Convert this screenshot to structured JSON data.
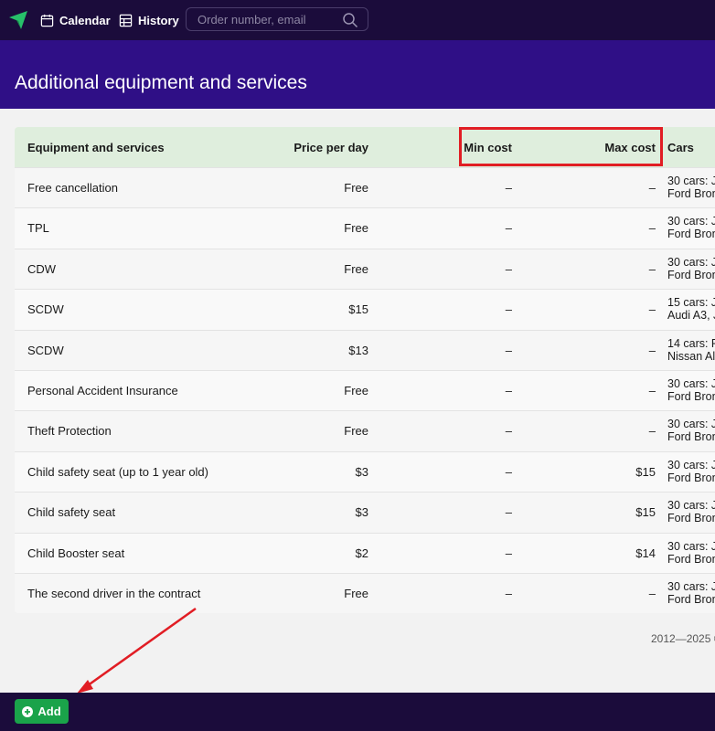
{
  "nav": {
    "calendar_label": "Calendar",
    "history_label": "History",
    "search_placeholder": "Order number, email"
  },
  "page": {
    "title": "Additional equipment and services"
  },
  "table": {
    "headers": {
      "name": "Equipment and services",
      "price": "Price per day",
      "min": "Min cost",
      "max": "Max cost",
      "cars": "Cars"
    },
    "rows": [
      {
        "name": "Free cancellation",
        "price": "Free",
        "min": "–",
        "max": "–",
        "cars1": "30 cars: J",
        "cars2": "Ford Bron"
      },
      {
        "name": "TPL",
        "price": "Free",
        "min": "–",
        "max": "–",
        "cars1": "30 cars: J",
        "cars2": "Ford Bron"
      },
      {
        "name": "CDW",
        "price": "Free",
        "min": "–",
        "max": "–",
        "cars1": "30 cars: J",
        "cars2": "Ford Bron"
      },
      {
        "name": "SCDW",
        "price": "$15",
        "min": "–",
        "max": "–",
        "cars1": "15 cars: Je",
        "cars2": "Audi A3, J"
      },
      {
        "name": "SCDW",
        "price": "$13",
        "min": "–",
        "max": "–",
        "cars1": "14 cars: F",
        "cars2": "Nissan Al"
      },
      {
        "name": "Personal Accident Insurance",
        "price": "Free",
        "min": "–",
        "max": "–",
        "cars1": "30 cars: J",
        "cars2": "Ford Bron"
      },
      {
        "name": "Theft Protection",
        "price": "Free",
        "min": "–",
        "max": "–",
        "cars1": "30 cars: J",
        "cars2": "Ford Bron"
      },
      {
        "name": "Child safety seat (up to 1 year old)",
        "price": "$3",
        "min": "–",
        "max": "$15",
        "cars1": "30 cars: J",
        "cars2": "Ford Bron"
      },
      {
        "name": "Child safety seat",
        "price": "$3",
        "min": "–",
        "max": "$15",
        "cars1": "30 cars: J",
        "cars2": "Ford Bron"
      },
      {
        "name": "Child Booster seat",
        "price": "$2",
        "min": "–",
        "max": "$14",
        "cars1": "30 cars: J",
        "cars2": "Ford Bron"
      },
      {
        "name": "The second driver in the contract",
        "price": "Free",
        "min": "–",
        "max": "–",
        "cars1": "30 cars: J",
        "cars2": "Ford Bron"
      }
    ]
  },
  "footer": {
    "copyright": "2012—2025 ©"
  },
  "actions": {
    "add_label": "Add"
  },
  "colors": {
    "nav_bg": "#1b0c3b",
    "banner_bg": "#2f0f86",
    "header_row_bg": "#dfeedd",
    "add_button": "#1aa34a",
    "annotation_red": "#e11d24"
  }
}
